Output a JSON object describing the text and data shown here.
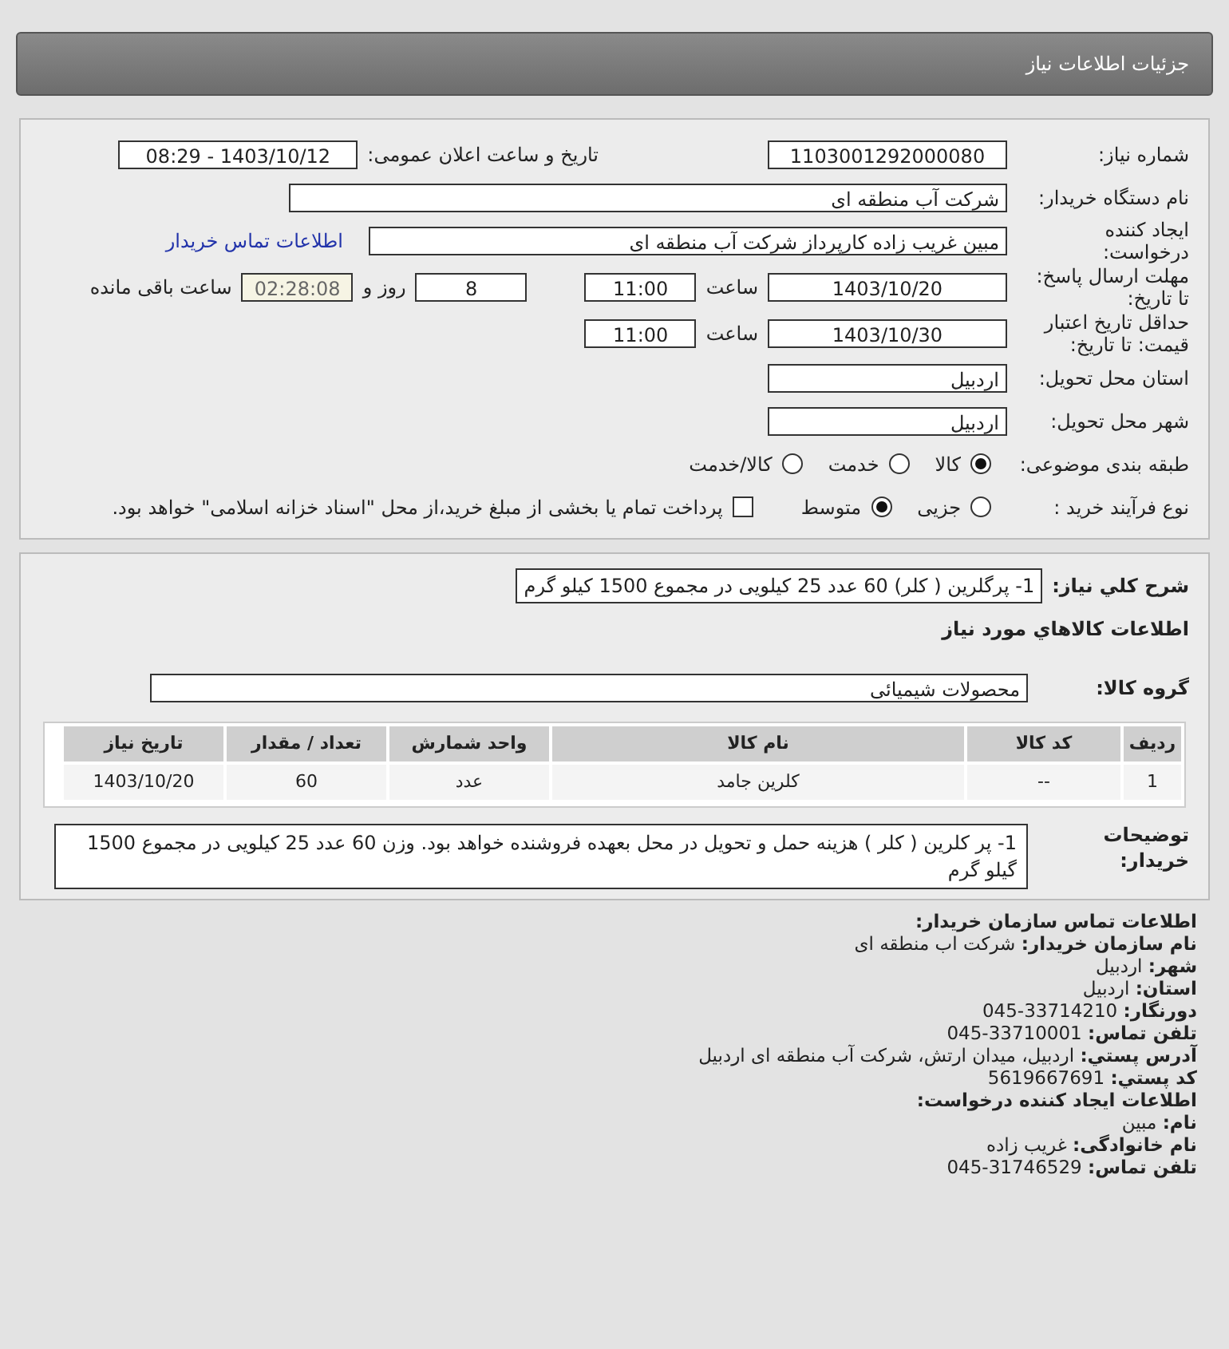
{
  "header": {
    "title": "جزئیات اطلاعات نیاز"
  },
  "details": {
    "need_number": {
      "label": "شماره نیاز:",
      "value": "1103001292000080"
    },
    "announce": {
      "label": "تاریخ و ساعت اعلان عمومی:",
      "value": "1403/10/12 - 08:29"
    },
    "buyer": {
      "label": "نام دستگاه خریدار:",
      "value": "شرکت آب منطقه ای"
    },
    "creator": {
      "label": [
        "ایجاد کننده",
        "درخواست:"
      ],
      "value": "مبین  غریب زاده کارپرداز شرکت آب منطقه ای",
      "link": "اطلاعات تماس خریدار"
    },
    "deadline": {
      "label": [
        "مهلت ارسال پاسخ:",
        "تا تاریخ:"
      ],
      "date": "1403/10/20",
      "time_label": "ساعت",
      "time": "11:00",
      "days": "8",
      "days_label": "روز و",
      "remaining": "02:28:08",
      "remaining_label": "ساعت باقی مانده"
    },
    "validity": {
      "label": [
        "حداقل تاریخ اعتبار",
        "قیمت: تا تاریخ:"
      ],
      "date": "1403/10/30",
      "time_label": "ساعت",
      "time": "11:00"
    },
    "province": {
      "label": "استان محل تحویل:",
      "value": "اردبیل"
    },
    "city": {
      "label": "شهر محل تحویل:",
      "value": "اردبیل"
    },
    "category": {
      "label": "طبقه بندی موضوعی:",
      "options": [
        {
          "label": "کالا",
          "selected": true
        },
        {
          "label": "خدمت",
          "selected": false
        },
        {
          "label": "کالا/خدمت",
          "selected": false
        }
      ]
    },
    "process": {
      "label": "نوع فرآیند خرید :",
      "options": [
        {
          "label": "جزیی",
          "selected": false
        },
        {
          "label": "متوسط",
          "selected": true
        }
      ],
      "payment": {
        "checked": false,
        "label": "پرداخت تمام یا بخشی از مبلغ خرید،از محل \"اسناد خزانه اسلامی\" خواهد بود."
      }
    }
  },
  "goods": {
    "summary": {
      "label": "شرح کلي نياز:",
      "value": "1- پرگلرین ( کلر) 60 عدد 25 کیلویی در مجموع 1500 کیلو گرم"
    },
    "heading": "اطلاعات کالاهاي مورد نياز",
    "group": {
      "label": "گروه کالا:",
      "value": "محصولات شیمیائی"
    },
    "table": {
      "columns": [
        "ردیف",
        "کد کالا",
        "نام کالا",
        "واحد شمارش",
        "تعداد / مقدار",
        "تاریخ نیاز"
      ],
      "rows": [
        [
          "1",
          "--",
          "کلرین جامد",
          "عدد",
          "60",
          "1403/10/20"
        ]
      ]
    },
    "notes": {
      "label": [
        "توضیحات",
        "خریدار:"
      ],
      "value": "1- پر کلرین ( کلر ) هزینه حمل و تحویل در محل بعهده فروشنده خواهد بود. وزن 60 عدد 25 کیلویی در مجموع 1500 گیلو گرم"
    }
  },
  "contact": [
    {
      "label": "اطلاعات تماس سازمان خریدار:"
    },
    {
      "label": "نام سازمان خریدار:",
      "value": "شرکت اب منطقه ای"
    },
    {
      "label": "شهر:",
      "value": "اردبیل"
    },
    {
      "label": "استان:",
      "value": "اردبیل"
    },
    {
      "label": "دورنگار:",
      "value": "33714210-045"
    },
    {
      "label": "تلفن تماس:",
      "value": "33710001-045"
    },
    {
      "label": "آدرس پستي:",
      "value": "اردبیل، میدان ارتش، شرکت آب منطقه ای اردبیل"
    },
    {
      "label": "کد پستي:",
      "value": "5619667691"
    },
    {
      "label": "اطلاعات ایجاد کننده درخواست:"
    },
    {
      "label": "نام:",
      "value": "مبین"
    },
    {
      "label": "نام خانوادگی:",
      "value": "غریب زاده"
    },
    {
      "label": "تلفن تماس:",
      "value": "31746529-045"
    }
  ]
}
